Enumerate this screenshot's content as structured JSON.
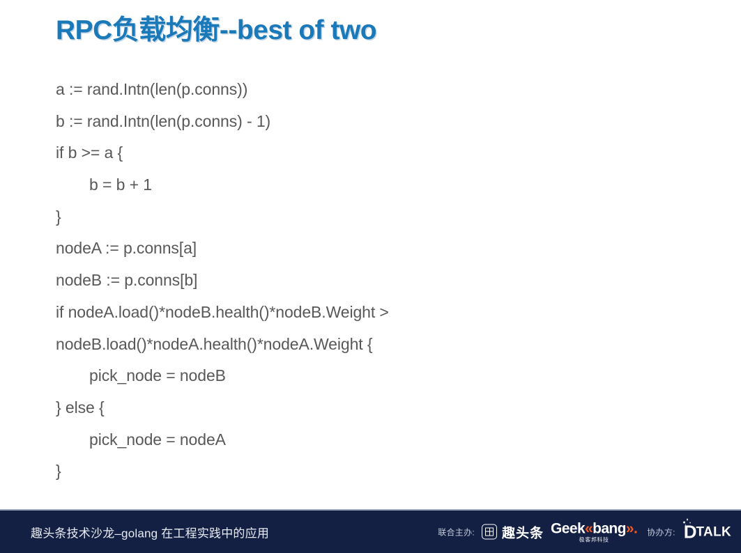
{
  "slide": {
    "title": "RPC负载均衡--best of two",
    "title_color": "#1a79b8",
    "code_lines": [
      {
        "text": "a := rand.Intn(len(p.conns))",
        "indent": 0
      },
      {
        "text": "b := rand.Intn(len(p.conns) - 1)",
        "indent": 0
      },
      {
        "text": "if b >= a {",
        "indent": 0
      },
      {
        "text": "b = b + 1",
        "indent": 1
      },
      {
        "text": "}",
        "indent": 0
      },
      {
        "text": "nodeA := p.conns[a]",
        "indent": 0
      },
      {
        "text": "nodeB := p.conns[b]",
        "indent": 0
      },
      {
        "text": "if nodeA.load()*nodeB.health()*nodeB.Weight >",
        "indent": 0
      },
      {
        "text": "nodeB.load()*nodeA.health()*nodeA.Weight {",
        "indent": 0
      },
      {
        "text": "pick_node = nodeB",
        "indent": 1
      },
      {
        "text": "} else {",
        "indent": 0
      },
      {
        "text": "pick_node = nodeA",
        "indent": 1
      },
      {
        "text": "}",
        "indent": 0
      }
    ]
  },
  "footer": {
    "background": "#131f43",
    "event_title": "趣头条技术沙龙–golang 在工程实践中的应用",
    "cohost": {
      "label": "联合主办:",
      "qutoutiao_name": "趣头条",
      "geekbang_part1": "Geek",
      "geekbang_accent1": "«",
      "geekbang_part2": "bang",
      "geekbang_accent2": "».",
      "geekbang_sub": "极客邦科技"
    },
    "coorganizer": {
      "label": "协办方:",
      "dtalk_d": "D",
      "dtalk_rest": "TALK"
    }
  }
}
